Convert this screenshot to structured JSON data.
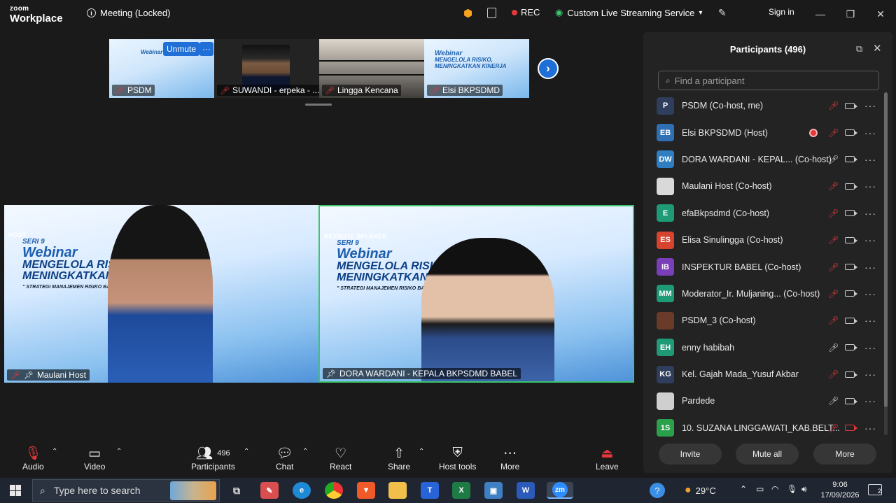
{
  "app": {
    "logo_top": "zoom",
    "logo_bottom": "Workplace",
    "meeting_title": "Meeting (Locked)"
  },
  "titlebar": {
    "rec": "REC",
    "streaming": "Custom Live Streaming Service",
    "signin": "Sign in"
  },
  "thumbnails": [
    {
      "name": "PSDM",
      "hover_button": "Unmute",
      "more": "···"
    },
    {
      "name": "SUWANDI - erpeka - ..."
    },
    {
      "name": "Lingga Kencana"
    },
    {
      "name": "Elsi BKPSDMD"
    }
  ],
  "thumbnail_banner": {
    "line1": "Webinar",
    "line2": "MENGELOLA RISIKO,",
    "line3": "MENINGKATKAN KINERJA"
  },
  "videos": [
    {
      "role": "HOST",
      "seri": "SERI 9",
      "title": "Webinar",
      "line1": "MENGELOLA RISIKO,",
      "line2": "MENINGKATKAN KINE",
      "sub": "\" STRATEGI MANAJEMEN RISIKO BAGI ASN DAN PE",
      "name": "Maulani Host"
    },
    {
      "role": "KEYNOTE SPEAKER",
      "seri": "SERI 9",
      "title": "Webinar",
      "line1": "MENGELOLA RISIKO,",
      "line2": "MENINGKATKAN KINERJA",
      "sub": "\" STRATEGI MANAJEMEN RISIKO BAGI ASN DAN PERANGKAT D",
      "name": "DORA WARDANI - KEPALA BKPSDMD BABEL"
    }
  ],
  "participants_panel": {
    "title": "Participants (496)",
    "search_placeholder": "Find a participant",
    "participants": [
      {
        "initials": "P",
        "color": "#2f3e5c",
        "name": "PSDM (Co-host, me)",
        "mic": "muted",
        "cam": "on"
      },
      {
        "initials": "EB",
        "color": "#2f6fb3",
        "name": "Elsi BKPSDMD (Host)",
        "mic": "muted",
        "cam": "on",
        "recording": true
      },
      {
        "initials": "DW",
        "color": "#2f7ec2",
        "name": "DORA WARDANI - KEPAL...  (Co-host)",
        "mic": "on",
        "cam": "on"
      },
      {
        "initials": "",
        "color": "#d9d9d9",
        "name": "Maulani Host (Co-host)",
        "mic": "muted",
        "cam": "on",
        "photo": true
      },
      {
        "initials": "E",
        "color": "#1f9a77",
        "name": "efaBkpsdmd (Co-host)",
        "mic": "muted",
        "cam": "on"
      },
      {
        "initials": "ES",
        "color": "#d8432e",
        "name": "Elisa Sinulingga (Co-host)",
        "mic": "muted",
        "cam": "on"
      },
      {
        "initials": "IB",
        "color": "#7a3fb8",
        "name": "INSPEKTUR BABEL (Co-host)",
        "mic": "muted",
        "cam": "on"
      },
      {
        "initials": "MM",
        "color": "#1f9a77",
        "name": "Moderator_Ir. Muljaning...  (Co-host)",
        "mic": "muted",
        "cam": "on"
      },
      {
        "initials": "",
        "color": "#6b3b2a",
        "name": "PSDM_3 (Co-host)",
        "mic": "muted",
        "cam": "on",
        "photo": true
      },
      {
        "initials": "EH",
        "color": "#1f9a77",
        "name": "enny habibah",
        "mic": "on",
        "cam": "on"
      },
      {
        "initials": "KG",
        "color": "#2f3e5c",
        "name": "Kel. Gajah Mada_Yusuf Akbar",
        "mic": "muted",
        "cam": "on"
      },
      {
        "initials": "",
        "color": "#cfcfcf",
        "name": "Pardede",
        "mic": "on",
        "cam": "on",
        "photo": true
      },
      {
        "initials": "1S",
        "color": "#2aa04a",
        "name": "10. SUZANA LINGGAWATI_KAB.BELT...",
        "mic": "muted",
        "cam": "off"
      }
    ],
    "buttons": {
      "invite": "Invite",
      "mute_all": "Mute all",
      "more": "More"
    }
  },
  "toolbar": {
    "audio": "Audio",
    "video": "Video",
    "participants": "Participants",
    "participants_count": "496",
    "chat": "Chat",
    "react": "React",
    "share": "Share",
    "host_tools": "Host tools",
    "more": "More",
    "leave": "Leave"
  },
  "taskbar": {
    "search_placeholder": "Type here to search",
    "weather": "29°C",
    "time": "9:06",
    "date": "17/09/2026",
    "notifications": "2",
    "apps": [
      "task-view",
      "paint",
      "edge",
      "chrome",
      "brave",
      "file-explorer",
      "teams",
      "excel",
      "photos",
      "word",
      "zoom"
    ]
  },
  "colors": {
    "accent": "#1f6fd6",
    "muted": "#e5383b",
    "active_speaker": "#3cc46e",
    "panel_bg": "#232323"
  }
}
